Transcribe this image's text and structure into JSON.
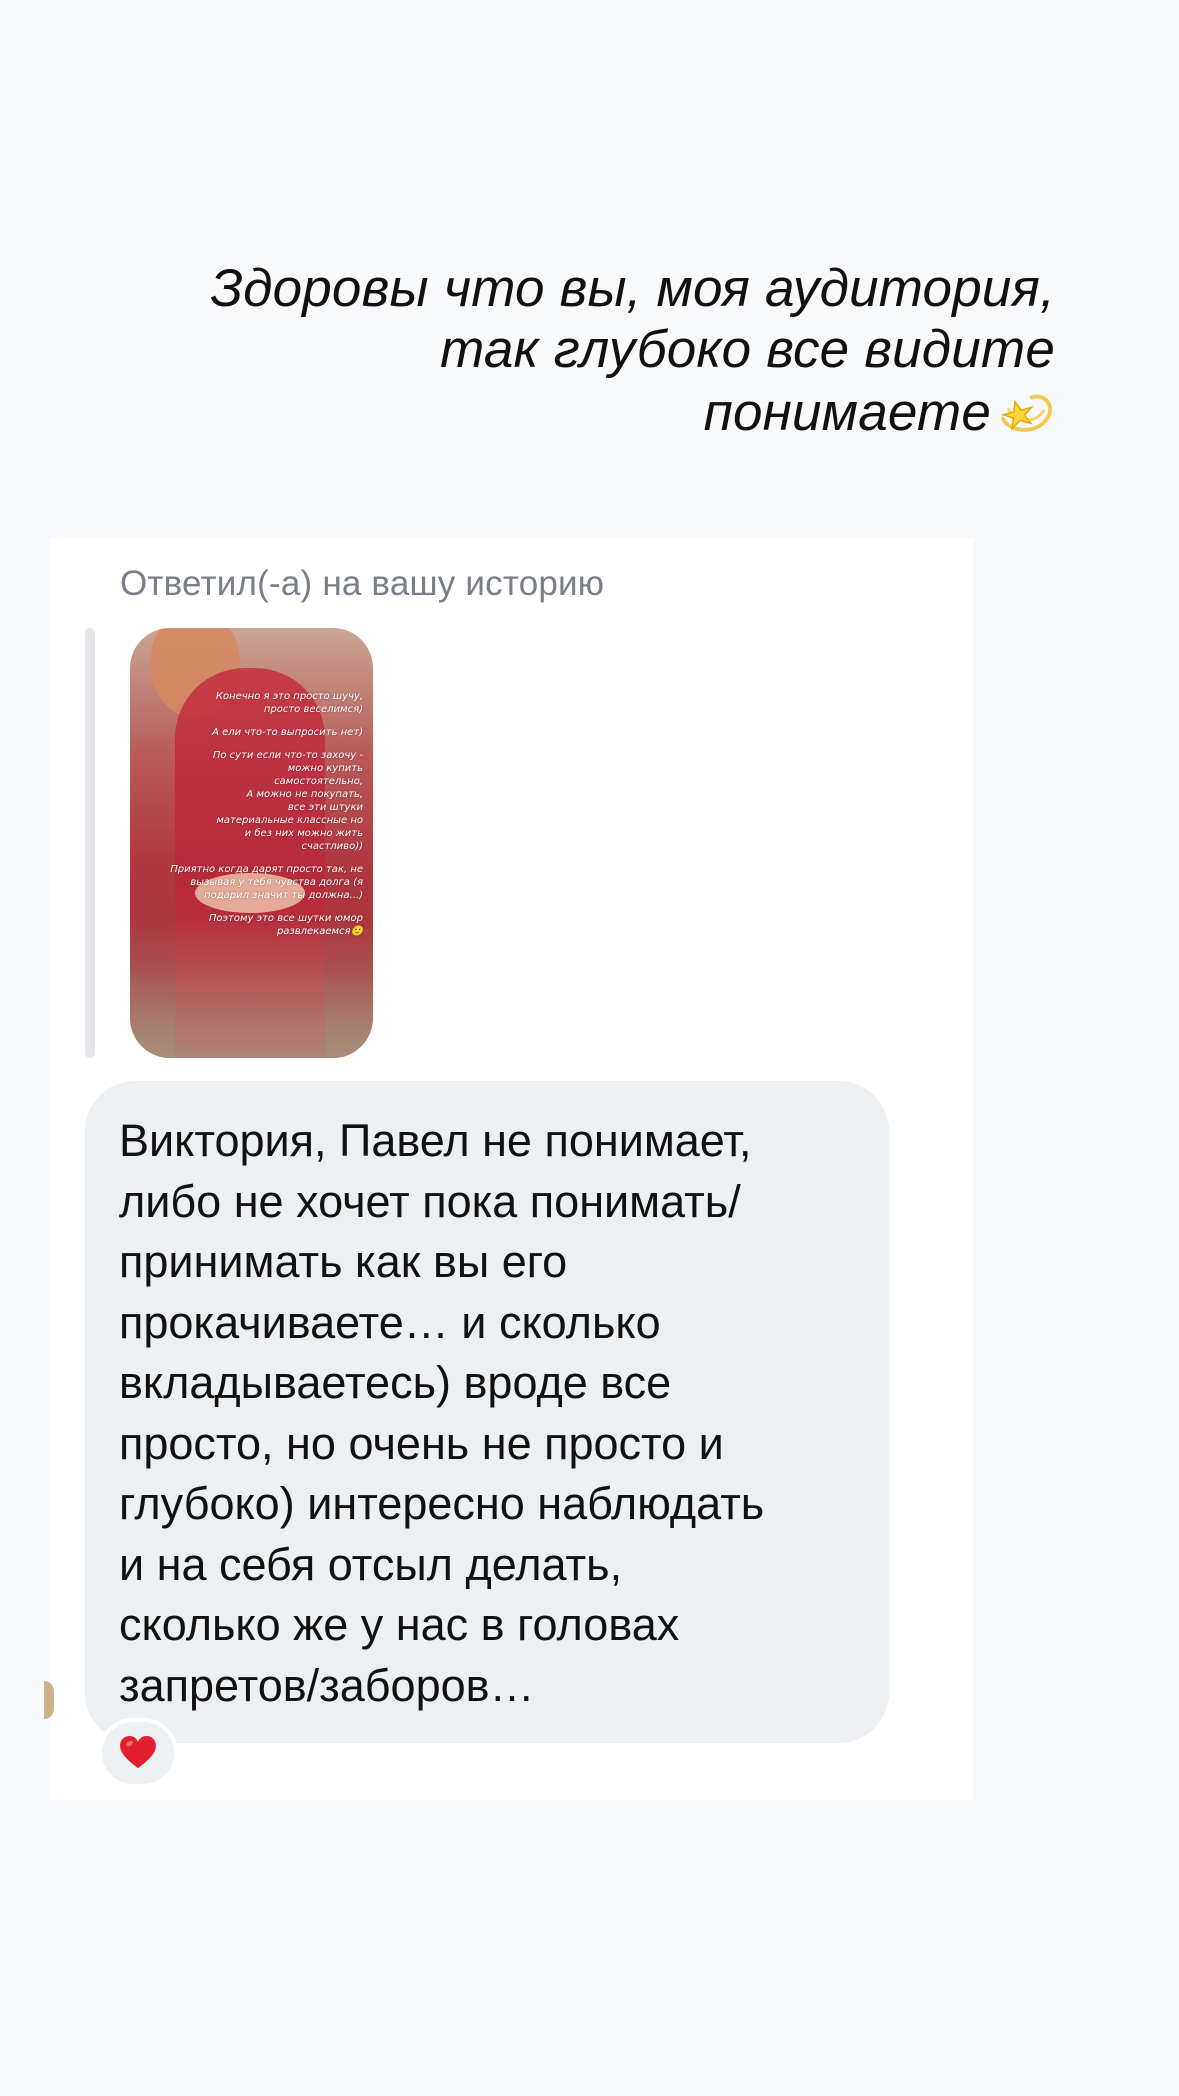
{
  "story_caption": {
    "line1": "Здоровы что вы, моя аудитория,",
    "line2": "так глубоко все видите",
    "line3": "понимаете",
    "emoji": "dizzy-star-emoji"
  },
  "reply": {
    "label": "Ответил(-а) на вашу историю",
    "story_text": [
      "Конечно я это просто шучу,\nпросто веселимся)",
      "А ели что-то выпросить нет)",
      "По сути если что-то захочу -\nможно купить\nсамостоятельно,\nА можно не покупать,\nвсе эти штуки\nматериальные классные но\nи без них можно жить\nсчастливо))",
      "Приятно когда дарят просто так, не\nвызывая у тебя чувства долга (я\nподарил значит ты должна...)",
      "Поэтому это все шутки юмор\nразвлекаемся🙂"
    ]
  },
  "message": {
    "text": "Виктория, Павел не понимает,\nлибо не хочет пока понимать/\nпринимать как вы его\nпрокачиваете… и сколько\nвкладываетесь)  вроде все\nпросто, но очень не просто и\nглубоко) интересно наблюдать\nи на себя отсыл делать,\nсколько же у нас в головах\nзапретов/заборов…",
    "reaction": "red-heart"
  },
  "colors": {
    "background": "#f8f9fb",
    "card": "#ffffff",
    "bubble": "#edf0f3",
    "label": "#7a7f87",
    "heart": "#e0202f"
  }
}
